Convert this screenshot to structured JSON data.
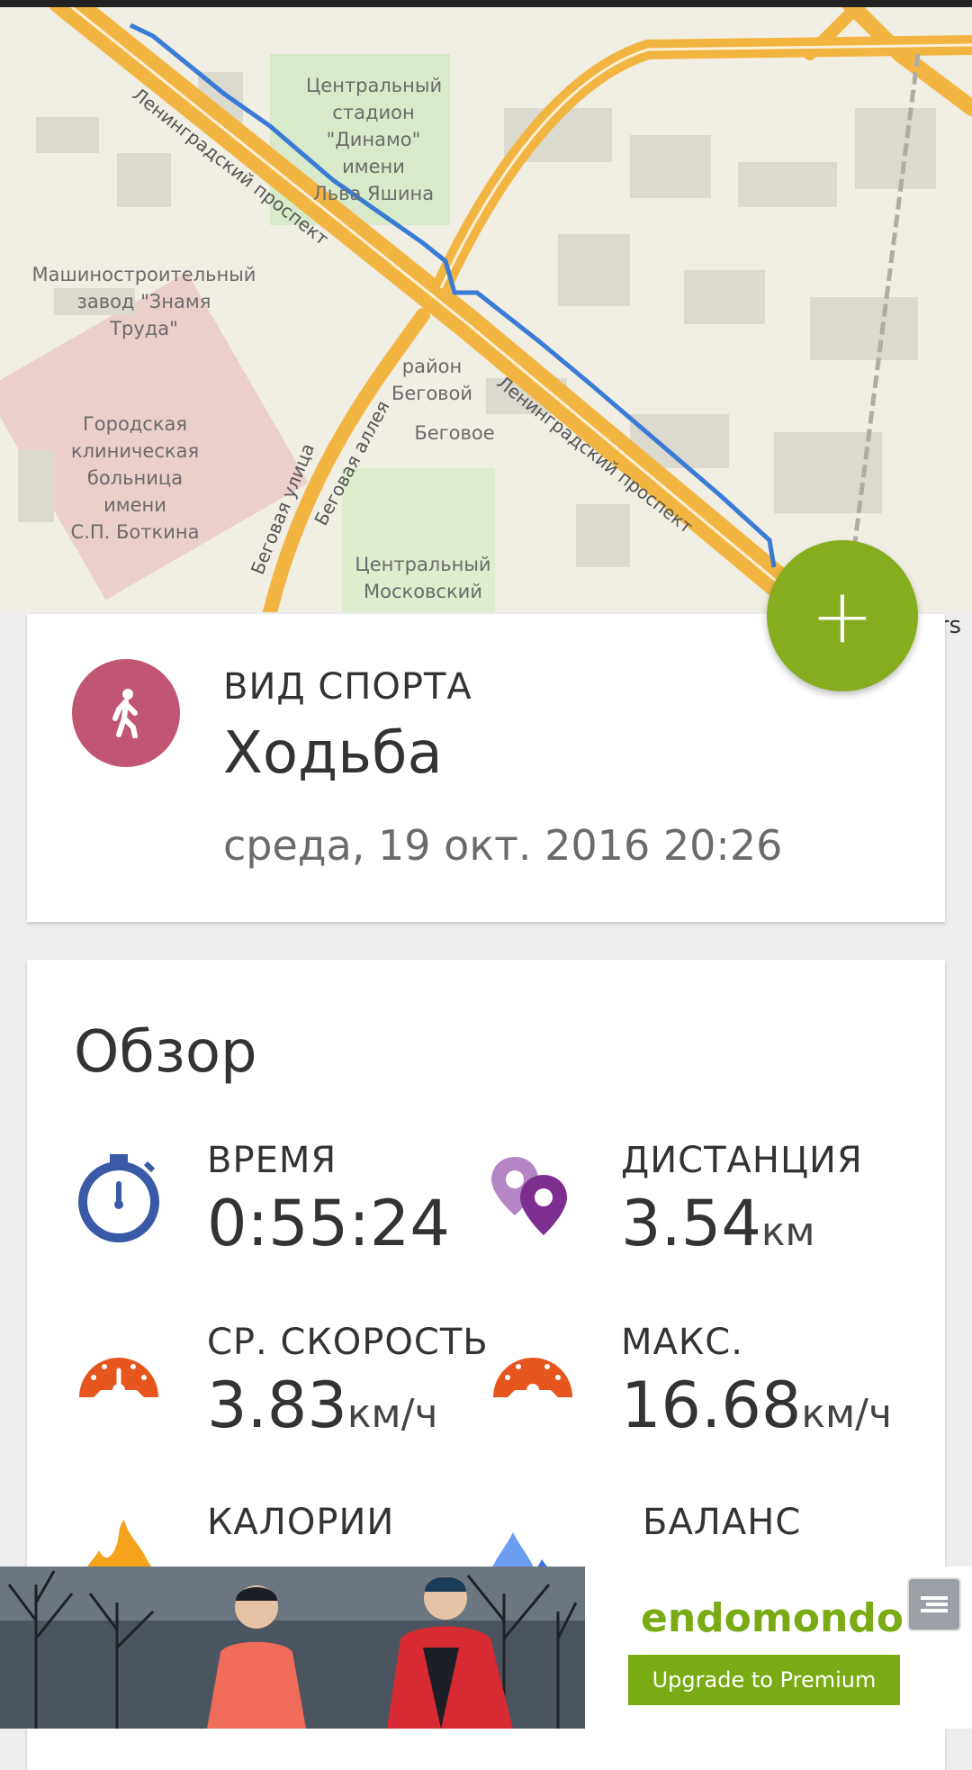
{
  "map": {
    "labels": {
      "stadium": "Центральный\nстадион\n\"Динамо\"\nимени\nЛьва Яшина",
      "factory": "Машиностроительный\nзавод \"Знамя\nТруда\"",
      "district": "район\nБеговой",
      "begovoe": "Беговое",
      "hospital": "Городская\nклиническая\nбольница\nимени\nС.П. Боткина",
      "moscow_center": "Центральный\nМосковский",
      "street_1": "Ленинградский проспект",
      "street_2": "Ленинградский проспект",
      "street_3": "Беговая улица",
      "street_4": "Беговая аллея"
    },
    "attribution": "rs",
    "route_color": "#3a7bd5",
    "road_color": "#f2b542"
  },
  "add_button": {
    "label": "+"
  },
  "sport": {
    "label": "ВИД СПОРТА",
    "value": "Ходьба",
    "date": "среда, 19 окт. 2016 20:26",
    "icon": "walking-person-icon",
    "color": "#c15574"
  },
  "overview": {
    "title": "Обзор",
    "time": {
      "label": "ВРЕМЯ",
      "value": "0:55:24",
      "unit": ""
    },
    "distance": {
      "label": "ДИСТАНЦИЯ",
      "value": "3.54",
      "unit": "км"
    },
    "avg_speed": {
      "label": "СР. СКОРОСТЬ",
      "value": "3.83",
      "unit": "км/ч"
    },
    "max_speed": {
      "label": "МАКС.",
      "value": "16.68",
      "unit": "км/ч"
    },
    "calories": {
      "label": "КАЛОРИИ"
    },
    "balance": {
      "label": "БАЛАНС"
    }
  },
  "ad": {
    "logo": "endomondo",
    "button": "Upgrade to Premium",
    "accent": "#7aaa14"
  }
}
